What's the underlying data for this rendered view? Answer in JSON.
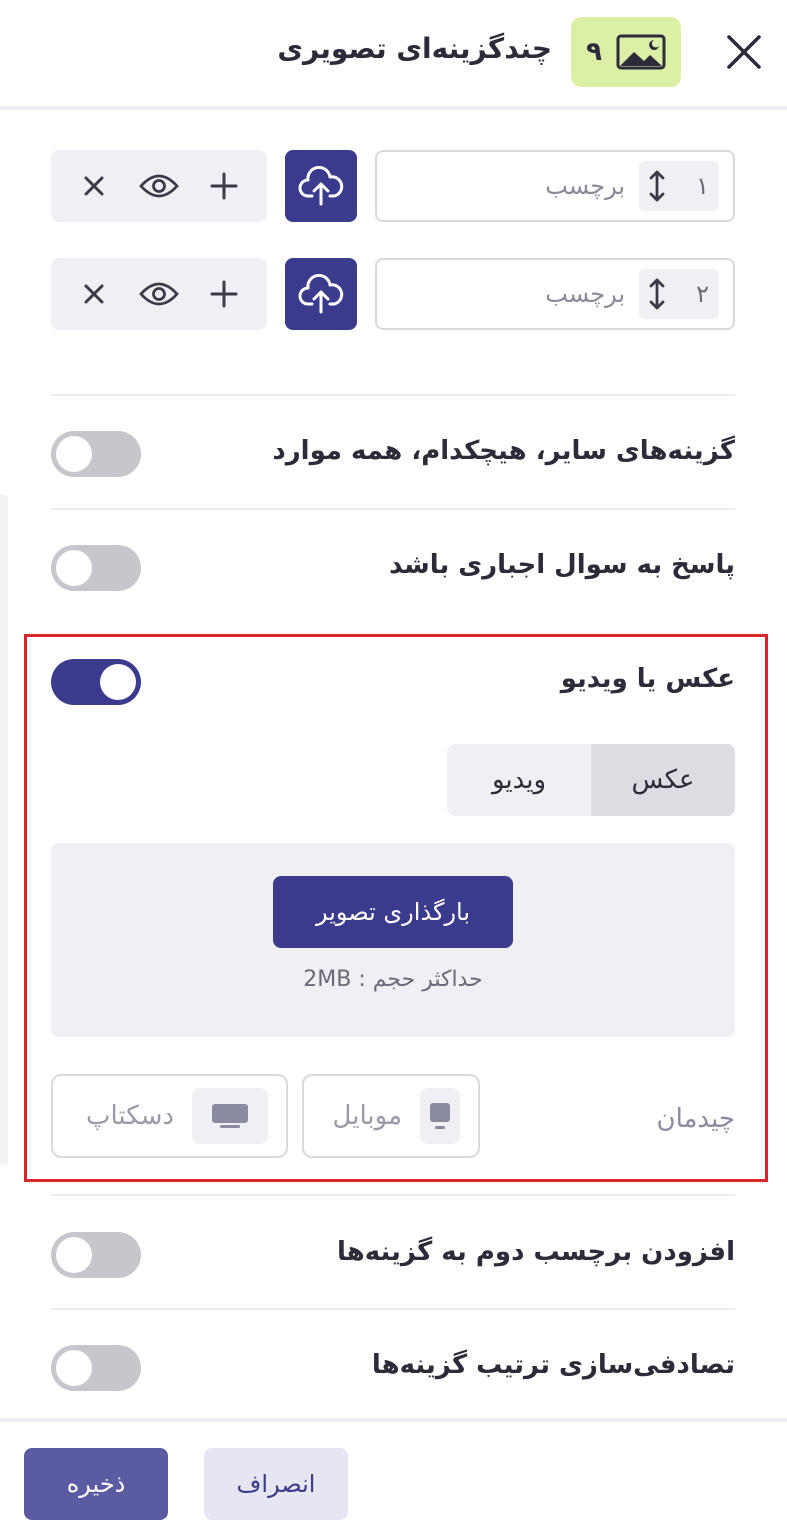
{
  "header": {
    "title": "چندگزینه‌ای تصویری",
    "question_number": "۹",
    "type_icon": "image-icon",
    "close_icon": "close-icon",
    "badge_color": "#dcefa6"
  },
  "options": [
    {
      "order": "۱",
      "label_placeholder": "برچسب"
    },
    {
      "order": "۲",
      "label_placeholder": "برچسب"
    }
  ],
  "option_icons": {
    "upload": "cloud-upload-icon",
    "add": "plus-icon",
    "preview": "eye-icon",
    "remove": "x-icon",
    "reorder": "updown-arrow-icon"
  },
  "settings": {
    "other_options": {
      "label": "گزینه‌های سایر، هیچکدام، همه موارد",
      "enabled": false
    },
    "required": {
      "label": "پاسخ به سوال اجباری باشد",
      "enabled": false
    },
    "media": {
      "label": "عکس یا ویدیو",
      "enabled": true
    },
    "second_label": {
      "label": "افزودن برچسب دوم به گزینه‌ها",
      "enabled": false
    },
    "randomize": {
      "label": "تصادفی‌سازی ترتیب گزینه‌ها",
      "enabled": false
    }
  },
  "media": {
    "tabs": [
      "عکس",
      "ویدیو"
    ],
    "active_tab": "عکس",
    "upload_button": "بارگذاری تصویر",
    "max_size": "حداکثر حجم : 2MB",
    "layout_label": "چیدمان",
    "layout_options": [
      {
        "label": "موبایل",
        "icon": "mobile-icon"
      },
      {
        "label": "دسکتاپ",
        "icon": "desktop-icon"
      }
    ]
  },
  "footer": {
    "save_label": "ذخیره",
    "cancel_label": "انصراف"
  },
  "colors": {
    "primary": "#3b3b8e",
    "highlight_border": "#d8262b",
    "toggle_off": "#c6c6cc"
  }
}
